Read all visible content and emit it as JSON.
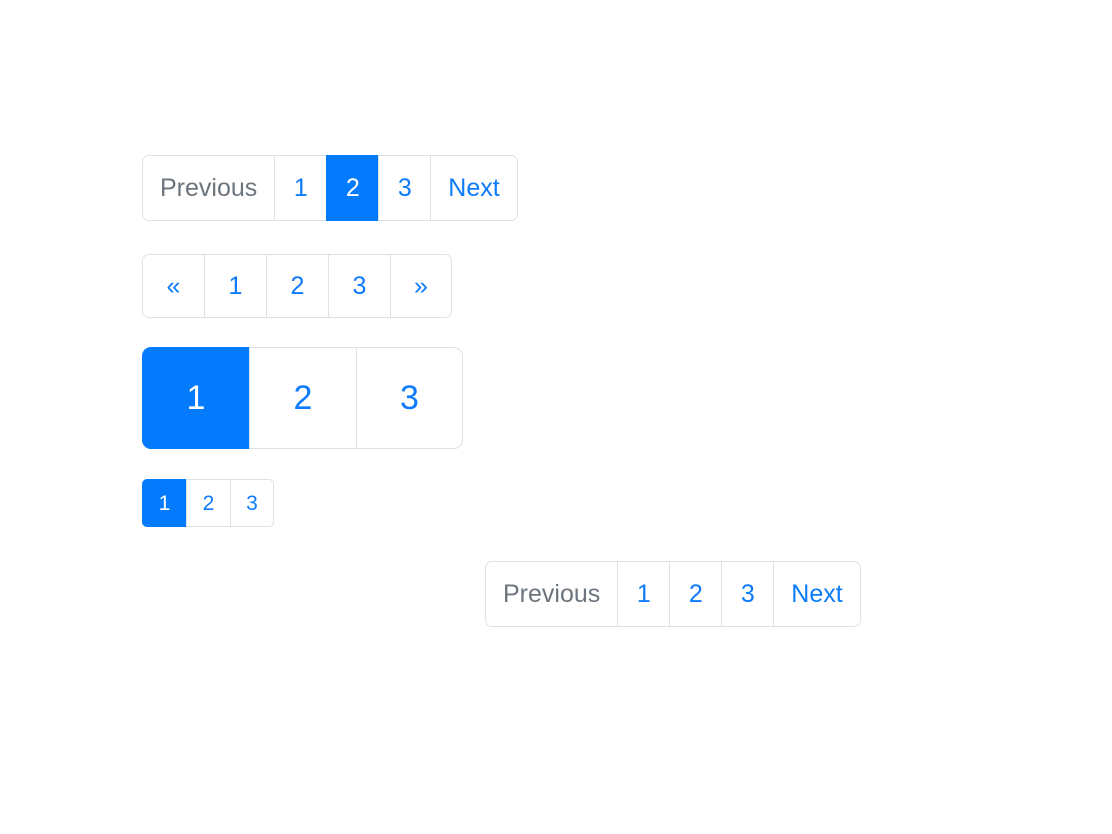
{
  "theme": {
    "background": "#ffffff",
    "link_color": "#0d7bfa",
    "active_bg": "#037bfc",
    "active_text": "#ffffff",
    "disabled_color": "#6c757d",
    "border_color": "#dee2e6"
  },
  "paginations": [
    {
      "id": "basic-pagination",
      "size": "md",
      "alignment": "left",
      "items": [
        {
          "label": "Previous",
          "name": "previous",
          "state": "disabled"
        },
        {
          "label": "1",
          "name": "page-1",
          "state": "default"
        },
        {
          "label": "2",
          "name": "page-2",
          "state": "active"
        },
        {
          "label": "3",
          "name": "page-3",
          "state": "default"
        },
        {
          "label": "Next",
          "name": "next",
          "state": "default"
        }
      ]
    },
    {
      "id": "icon-pagination",
      "size": "md",
      "alignment": "left",
      "items": [
        {
          "label": "«",
          "name": "previous-chevron-icon",
          "state": "default"
        },
        {
          "label": "1",
          "name": "page-1",
          "state": "default"
        },
        {
          "label": "2",
          "name": "page-2",
          "state": "default"
        },
        {
          "label": "3",
          "name": "page-3",
          "state": "default"
        },
        {
          "label": "»",
          "name": "next-chevron-icon",
          "state": "default"
        }
      ]
    },
    {
      "id": "large-pagination",
      "size": "lg",
      "alignment": "left",
      "items": [
        {
          "label": "1",
          "name": "page-1",
          "state": "active"
        },
        {
          "label": "2",
          "name": "page-2",
          "state": "default"
        },
        {
          "label": "3",
          "name": "page-3",
          "state": "default"
        }
      ]
    },
    {
      "id": "small-pagination",
      "size": "sm",
      "alignment": "left",
      "items": [
        {
          "label": "1",
          "name": "page-1",
          "state": "active"
        },
        {
          "label": "2",
          "name": "page-2",
          "state": "default"
        },
        {
          "label": "3",
          "name": "page-3",
          "state": "default"
        }
      ]
    },
    {
      "id": "right-aligned-pagination",
      "size": "md",
      "alignment": "right",
      "items": [
        {
          "label": "Previous",
          "name": "previous",
          "state": "disabled"
        },
        {
          "label": "1",
          "name": "page-1",
          "state": "default"
        },
        {
          "label": "2",
          "name": "page-2",
          "state": "default"
        },
        {
          "label": "3",
          "name": "page-3",
          "state": "default"
        },
        {
          "label": "Next",
          "name": "next",
          "state": "default"
        }
      ]
    }
  ]
}
